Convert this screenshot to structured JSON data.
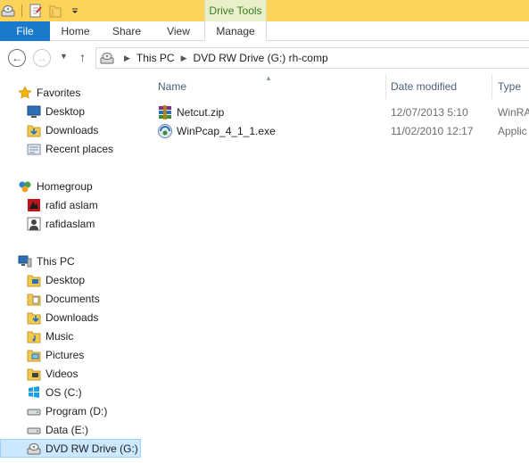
{
  "titlebar": {
    "context_tab_label": "Drive Tools"
  },
  "ribbon": {
    "tabs": [
      {
        "label": "File"
      },
      {
        "label": "Home"
      },
      {
        "label": "Share"
      },
      {
        "label": "View"
      },
      {
        "label": "Manage"
      }
    ]
  },
  "address": {
    "crumbs": [
      {
        "label": "This PC"
      },
      {
        "label": "DVD RW Drive (G:) rh-comp"
      }
    ]
  },
  "sidebar": {
    "favorites": {
      "label": "Favorites",
      "items": [
        {
          "label": "Desktop"
        },
        {
          "label": "Downloads"
        },
        {
          "label": "Recent places"
        }
      ]
    },
    "homegroup": {
      "label": "Homegroup",
      "items": [
        {
          "label": "rafid aslam"
        },
        {
          "label": "rafidaslam"
        }
      ]
    },
    "thispc": {
      "label": "This PC",
      "items": [
        {
          "label": "Desktop"
        },
        {
          "label": "Documents"
        },
        {
          "label": "Downloads"
        },
        {
          "label": "Music"
        },
        {
          "label": "Pictures"
        },
        {
          "label": "Videos"
        },
        {
          "label": "OS (C:)"
        },
        {
          "label": "Program (D:)"
        },
        {
          "label": "Data (E:)"
        },
        {
          "label": "DVD RW Drive (G:) rh"
        }
      ]
    }
  },
  "columns": {
    "name": "Name",
    "date_modified": "Date modified",
    "type": "Type"
  },
  "files": [
    {
      "name": "Netcut.zip",
      "date": "12/07/2013 5:10",
      "type": "WinRA",
      "icon": "winrar-archive-icon"
    },
    {
      "name": "WinPcap_4_1_1.exe",
      "date": "11/02/2010 12:17",
      "type": "Applic",
      "icon": "installer-exe-icon"
    }
  ],
  "colors": {
    "titlebar": "#fcd35a",
    "file_tab": "#1979ca",
    "context_tab": "#e9f0c9",
    "selection": "#cce8ff"
  }
}
